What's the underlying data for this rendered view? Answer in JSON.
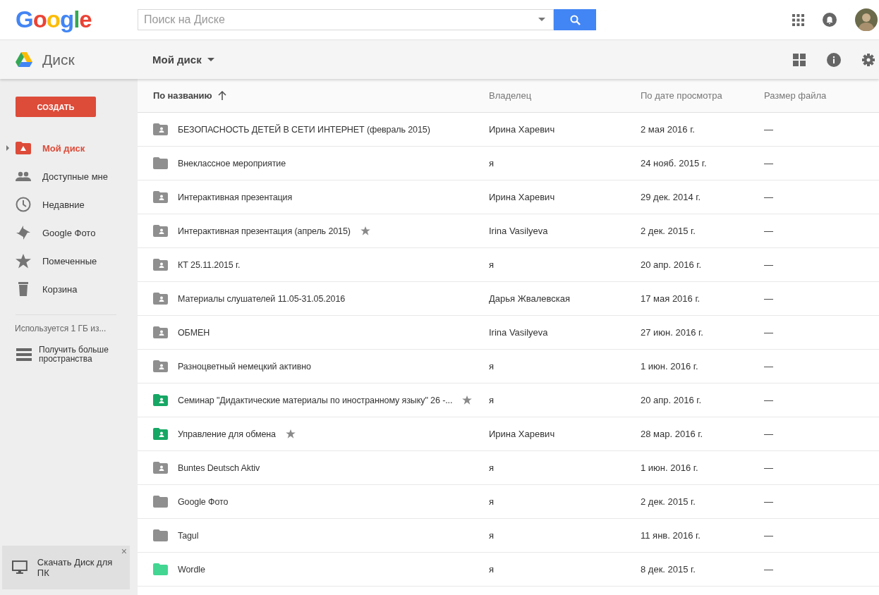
{
  "header": {
    "logo": "Google",
    "search": {
      "placeholder": "Поиск на Диске"
    }
  },
  "toolbar": {
    "app_name": "Диск",
    "location": "Мой диск"
  },
  "sidebar": {
    "create_button": "СОЗДАТЬ",
    "items": [
      {
        "label": "Мой диск",
        "selected": true
      },
      {
        "label": "Доступные мне",
        "selected": false
      },
      {
        "label": "Недавние",
        "selected": false
      },
      {
        "label": "Google Фото",
        "selected": false
      },
      {
        "label": "Помеченные",
        "selected": false
      },
      {
        "label": "Корзина",
        "selected": false
      }
    ],
    "storage": "Используется 1 ГБ из...",
    "get_more": "Получить больше пространства",
    "download_promo": "Скачать Диск для ПК",
    "close": "×"
  },
  "table": {
    "columns": [
      {
        "label": "По названию",
        "sorted": true
      },
      {
        "label": "Владелец",
        "sorted": false
      },
      {
        "label": "По дате просмотра",
        "sorted": false
      },
      {
        "label": "Размер файла",
        "sorted": false
      }
    ],
    "rows": [
      {
        "name": "БЕЗОПАСНОСТЬ ДЕТЕЙ В СЕТИ ИНТЕРНЕТ (февраль 2015)",
        "shared": true,
        "color": "#8f8f8f",
        "starred": false,
        "owner": "Ирина Харевич",
        "date": "2 мая 2016 г.",
        "size": "—"
      },
      {
        "name": "Внеклассное мероприятие",
        "shared": false,
        "color": "#8f8f8f",
        "starred": false,
        "owner": "я",
        "date": "24 нояб. 2015 г.",
        "size": "—"
      },
      {
        "name": "Интерактивная презентация",
        "shared": true,
        "color": "#8f8f8f",
        "starred": false,
        "owner": "Ирина Харевич",
        "date": "29 дек. 2014 г.",
        "size": "—"
      },
      {
        "name": "Интерактивная презентация (апрель 2015)",
        "shared": true,
        "color": "#8f8f8f",
        "starred": true,
        "owner": "Irina Vasilyeva",
        "date": "2 дек. 2015 г.",
        "size": "—"
      },
      {
        "name": "КТ 25.11.2015 г.",
        "shared": true,
        "color": "#8f8f8f",
        "starred": false,
        "owner": "я",
        "date": "20 апр. 2016 г.",
        "size": "—"
      },
      {
        "name": "Материалы слушателей 11.05-31.05.2016",
        "shared": true,
        "color": "#8f8f8f",
        "starred": false,
        "owner": "Дарья Жвалевская",
        "date": "17 мая 2016 г.",
        "size": "—"
      },
      {
        "name": "ОБМЕН",
        "shared": true,
        "color": "#8f8f8f",
        "starred": false,
        "owner": "Irina Vasilyeva",
        "date": "27 июн. 2016 г.",
        "size": "—"
      },
      {
        "name": "Разноцветный немецкий активно",
        "shared": true,
        "color": "#8f8f8f",
        "starred": false,
        "owner": "я",
        "date": "1 июн. 2016 г.",
        "size": "—"
      },
      {
        "name": "Семинар \"Дидактические материалы по иностранному языку\" 26 -...",
        "shared": true,
        "color": "#16a765",
        "starred": true,
        "owner": "я",
        "date": "20 апр. 2016 г.",
        "size": "—"
      },
      {
        "name": "Управление для обмена",
        "shared": true,
        "color": "#16a765",
        "starred": true,
        "owner": "Ирина Харевич",
        "date": "28 мар. 2016 г.",
        "size": "—"
      },
      {
        "name": "Buntes Deutsch Aktiv",
        "shared": true,
        "color": "#8f8f8f",
        "starred": false,
        "owner": "я",
        "date": "1 июн. 2016 г.",
        "size": "—"
      },
      {
        "name": "Google Фото",
        "shared": false,
        "color": "#8f8f8f",
        "starred": false,
        "owner": "я",
        "date": "2 дек. 2015 г.",
        "size": "—"
      },
      {
        "name": "Tagul",
        "shared": false,
        "color": "#8f8f8f",
        "starred": false,
        "owner": "я",
        "date": "11 янв. 2016 г.",
        "size": "—"
      },
      {
        "name": "Wordle",
        "shared": false,
        "color": "#42d692",
        "starred": false,
        "owner": "я",
        "date": "8 дек. 2015 г.",
        "size": "—"
      }
    ]
  }
}
